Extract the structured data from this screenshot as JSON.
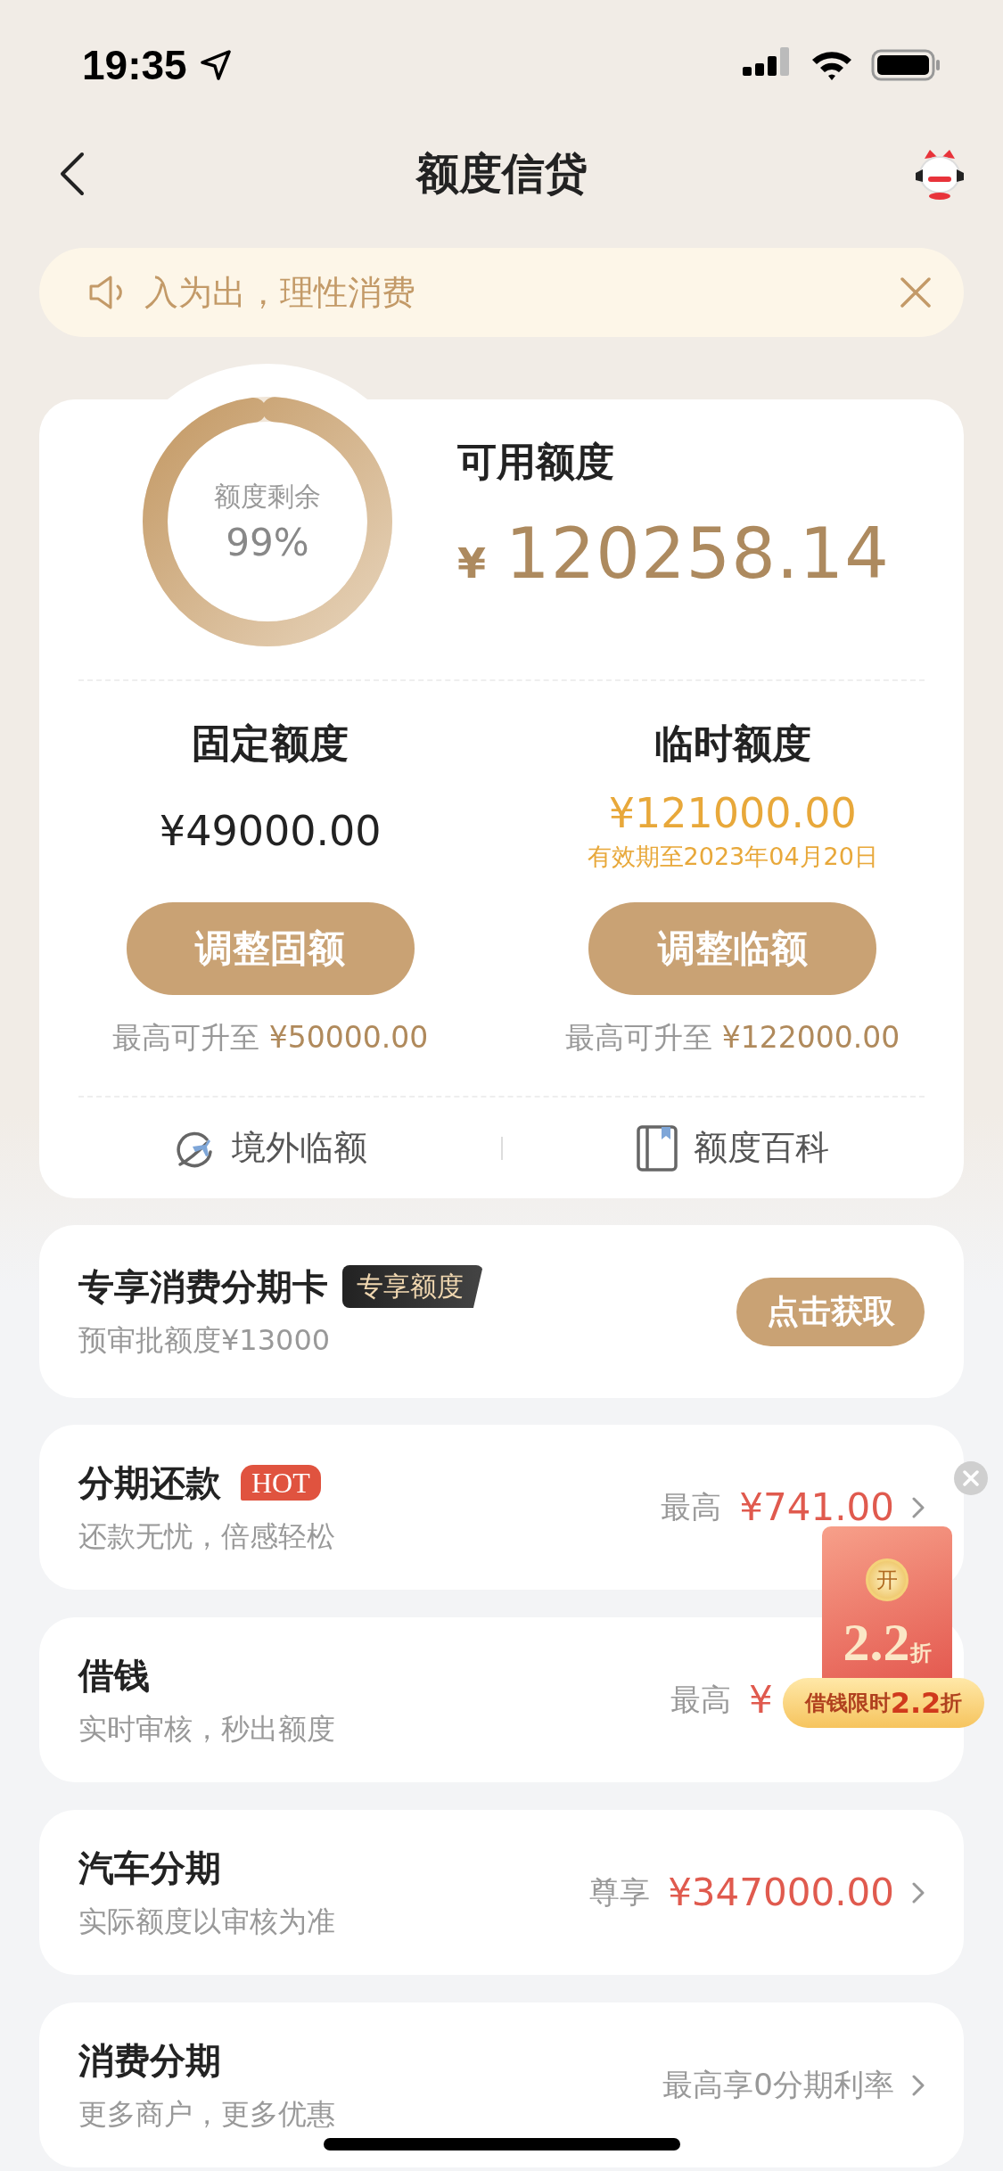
{
  "status_bar": {
    "time": "19:35"
  },
  "nav": {
    "title": "额度信贷"
  },
  "notice": {
    "text": "入为出，理性消费"
  },
  "credit": {
    "ring": {
      "label": "额度剩余",
      "percent": "99%",
      "level": 0.99
    },
    "available": {
      "label": "可用额度",
      "currency": "¥",
      "amount": "120258.14"
    },
    "columns": [
      {
        "title": "固定额度",
        "amount": "¥49000.00",
        "highlighted": false,
        "button": "调整固额",
        "note": "最高可升至",
        "note_amount": "¥50000.00"
      },
      {
        "title": "临时额度",
        "amount": "¥121000.00",
        "highlighted": true,
        "validity": "有效期至2023年04月20日",
        "button": "调整临额",
        "note": "最高可升至",
        "note_amount": "¥122000.00"
      }
    ],
    "links": [
      {
        "kind": "plane",
        "label": "境外临额"
      },
      {
        "kind": "book",
        "label": "额度百科"
      }
    ]
  },
  "exclusive": {
    "title": "专享消费分期卡",
    "badge": "专享额度",
    "subtitle": "预审批额度¥13000",
    "button": "点击获取"
  },
  "products": [
    {
      "title": "分期还款",
      "badge": "HOT",
      "subtitle": "还款无忧，倍感轻松",
      "prefix": "最高",
      "amount": "¥741.00",
      "arrow": true
    },
    {
      "title": "借钱",
      "subtitle": "实时审核，秒出额度",
      "prefix": "最高",
      "amount": "¥",
      "arrow": false
    },
    {
      "title": "汽车分期",
      "subtitle": "实际额度以审核为准",
      "prefix": "尊享",
      "amount": "¥347000.00",
      "arrow": true
    },
    {
      "title": "消费分期",
      "subtitle": "更多商户，更多优惠",
      "prefix": "最高享0分期利率",
      "arrow": true
    }
  ],
  "promo": {
    "coin": "开",
    "discount": "2.2$_{折}$",
    "caption": "借钱限时**2.2**折"
  }
}
